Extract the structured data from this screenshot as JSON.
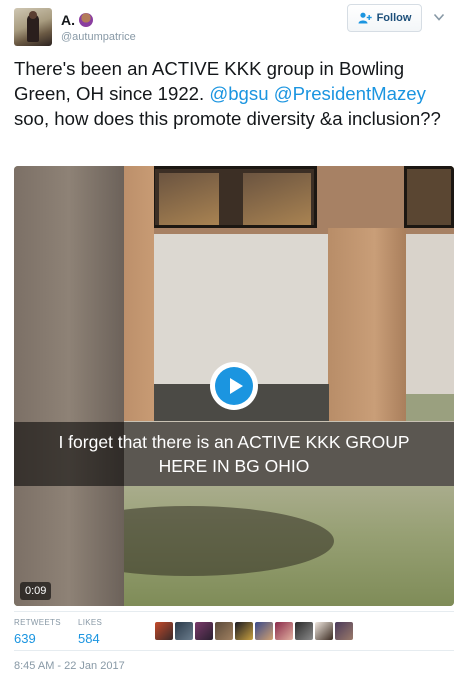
{
  "user": {
    "display_name": "A.",
    "handle": "@autumpatrice",
    "emoji_icon": "woman-tipping-hand-icon"
  },
  "follow_button": {
    "label": "Follow",
    "icon": "add-person-icon"
  },
  "tweet": {
    "text_parts": [
      "There's been an ACTIVE KKK group in Bowling Green, OH since 1922. ",
      "@bgsu",
      " ",
      "@PresidentMazey",
      " soo, how does this promote diversity &a inclusion??"
    ]
  },
  "media": {
    "caption_line1": "I forget that there is an ACTIVE KKK GROUP",
    "caption_line2": "HERE IN BG OHIO",
    "duration": "0:09",
    "play_icon": "play-icon"
  },
  "stats": {
    "retweets_label": "RETWEETS",
    "retweets_value": "639",
    "likes_label": "LIKES",
    "likes_value": "584",
    "liker_count_shown": 10
  },
  "timestamp": "8:45 AM - 22 Jan 2017",
  "colors": {
    "accent": "#1b95e0",
    "text": "#14171a",
    "muted": "#8899a6"
  }
}
